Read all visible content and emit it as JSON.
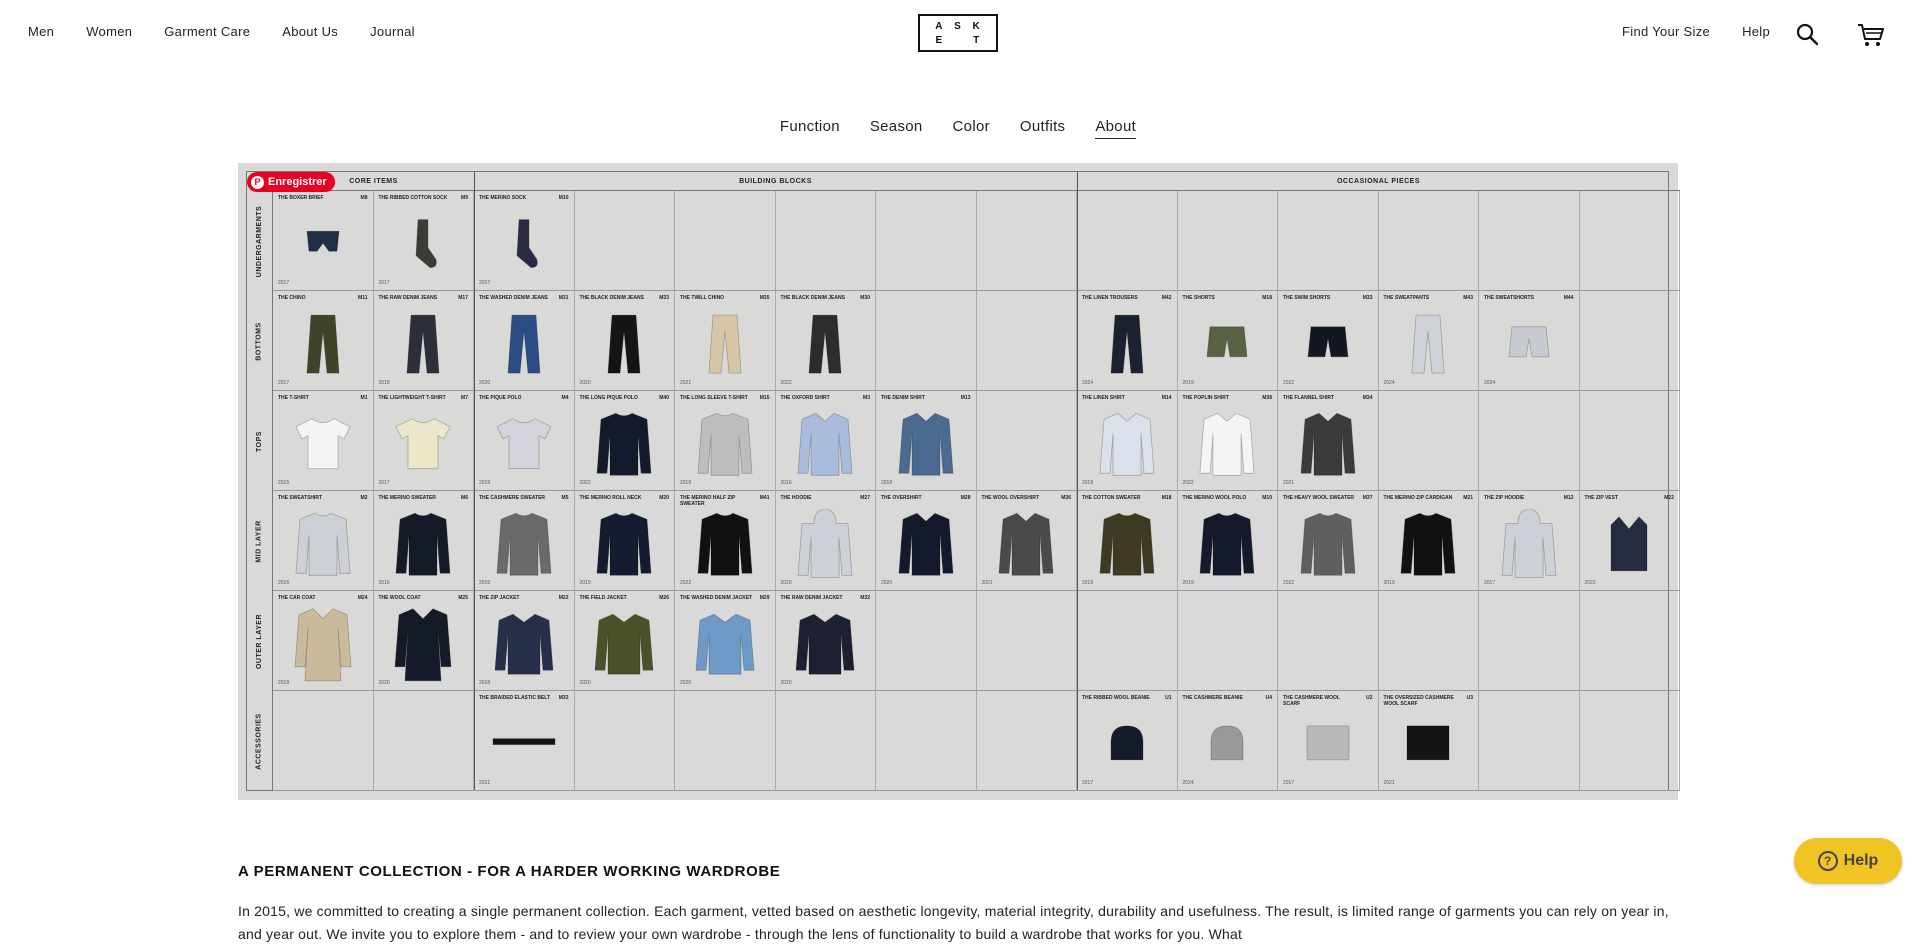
{
  "header": {
    "nav_left": [
      "Men",
      "Women",
      "Garment Care",
      "About Us",
      "Journal"
    ],
    "logo_letters": [
      "A",
      "S",
      "K",
      "E",
      "",
      "T"
    ],
    "nav_right": [
      "Find Your Size",
      "Help"
    ]
  },
  "subnav": {
    "items": [
      "Function",
      "Season",
      "Color",
      "Outfits",
      "About"
    ],
    "active": "About"
  },
  "wardrobe": {
    "sections": [
      "CORE ITEMS",
      "BUILDING BLOCKS",
      "OCCASIONAL PIECES"
    ],
    "rows": [
      "UNDERGARMENTS",
      "BOTTOMS",
      "TOPS",
      "MID LAYER",
      "OUTER LAYER",
      "ACCESSORIES"
    ],
    "pin_label": "Enregistrer",
    "cells": [
      [
        {
          "t": "THE BOXER BRIEF",
          "c": "M8",
          "y": "2017",
          "g": "brief",
          "col": "#1f2d45"
        },
        {
          "t": "THE RIBBED COTTON SOCK",
          "c": "M9",
          "y": "2017",
          "g": "sock",
          "col": "#3b3b38"
        },
        {
          "t": "THE MERINO SOCK",
          "c": "M10",
          "y": "2017",
          "g": "sock",
          "col": "#2a2a45"
        },
        null,
        null,
        null,
        null,
        null,
        null,
        null,
        null,
        null,
        null,
        null
      ],
      [
        {
          "t": "THE CHINO",
          "c": "M11",
          "y": "2017",
          "g": "pants",
          "col": "#3f4429"
        },
        {
          "t": "THE RAW DENIM JEANS",
          "c": "M17",
          "y": "2018",
          "g": "pants",
          "col": "#2c2f3a"
        },
        {
          "t": "THE WASHED DENIM JEANS",
          "c": "M31",
          "y": "2020",
          "g": "pants",
          "col": "#2a4d86"
        },
        {
          "t": "THE BLACK DENIM JEANS",
          "c": "M33",
          "y": "2020",
          "g": "pants",
          "col": "#141414"
        },
        {
          "t": "THE TWILL CHINO",
          "c": "M35",
          "y": "2021",
          "g": "pants",
          "col": "#d6c6a5"
        },
        {
          "t": "THE BLACK DENIM JEANS",
          "c": "M30",
          "y": "2022",
          "g": "pants",
          "col": "#2b2d2d"
        },
        null,
        null,
        {
          "t": "THE LINEN TROUSERS",
          "c": "M42",
          "y": "2024",
          "g": "pants",
          "col": "#1c2130"
        },
        {
          "t": "THE SHORTS",
          "c": "M18",
          "y": "2019",
          "g": "shorts",
          "col": "#5a6244"
        },
        {
          "t": "THE SWIM SHORTS",
          "c": "M33",
          "y": "2022",
          "g": "shorts",
          "col": "#121722"
        },
        {
          "t": "THE SWEATPANTS",
          "c": "M43",
          "y": "2024",
          "g": "pants",
          "col": "#cfd2d6"
        },
        {
          "t": "THE SWEATSHORTS",
          "c": "M44",
          "y": "2024",
          "g": "shorts",
          "col": "#c8ccd2"
        },
        null
      ],
      [
        {
          "t": "THE T-SHIRT",
          "c": "M1",
          "y": "2015",
          "g": "tee",
          "col": "#f4f4f4"
        },
        {
          "t": "THE LIGHTWEIGHT T-SHIRT",
          "c": "M7",
          "y": "2017",
          "g": "tee",
          "col": "#ece7c8"
        },
        {
          "t": "THE PIQUE POLO",
          "c": "M4",
          "y": "2019",
          "g": "tee",
          "col": "#d3d4dc"
        },
        {
          "t": "THE LONG PIQUE POLO",
          "c": "M40",
          "y": "2022",
          "g": "sweater",
          "col": "#141a2b"
        },
        {
          "t": "THE LONG SLEEVE T-SHIRT",
          "c": "M15",
          "y": "2018",
          "g": "sweater",
          "col": "#bdbdbd"
        },
        {
          "t": "THE OXFORD SHIRT",
          "c": "M3",
          "y": "2016",
          "g": "shirt",
          "col": "#a9bcdd"
        },
        {
          "t": "THE DENIM SHIRT",
          "c": "M13",
          "y": "2018",
          "g": "shirt",
          "col": "#4b6a90"
        },
        null,
        {
          "t": "THE LINEN SHIRT",
          "c": "M14",
          "y": "2018",
          "g": "shirt",
          "col": "#dbe1ea"
        },
        {
          "t": "THE POPLIN SHIRT",
          "c": "M38",
          "y": "2022",
          "g": "shirt",
          "col": "#f4f4f4"
        },
        {
          "t": "THE FLANNEL SHIRT",
          "c": "M34",
          "y": "2021",
          "g": "shirt",
          "col": "#3a3a3a"
        },
        null,
        null,
        null
      ],
      [
        {
          "t": "THE SWEATSHIRT",
          "c": "M2",
          "y": "2016",
          "g": "sweater",
          "col": "#cdd0d6"
        },
        {
          "t": "THE MERINO SWEATER",
          "c": "M6",
          "y": "2016",
          "g": "sweater",
          "col": "#141a28"
        },
        {
          "t": "THE CASHMERE SWEATER",
          "c": "M5",
          "y": "2016",
          "g": "sweater",
          "col": "#6a6a6a"
        },
        {
          "t": "THE MERINO ROLL NECK",
          "c": "M20",
          "y": "2019",
          "g": "sweater",
          "col": "#141b2e"
        },
        {
          "t": "THE MERINO HALF ZIP SWEATER",
          "c": "M41",
          "y": "2022",
          "g": "sweater",
          "col": "#111111"
        },
        {
          "t": "THE HOODIE",
          "c": "M27",
          "y": "2020",
          "g": "hoodie",
          "col": "#cdd0d6"
        },
        {
          "t": "THE OVERSHIRT",
          "c": "M28",
          "y": "2020",
          "g": "shirt",
          "col": "#141a2b"
        },
        {
          "t": "THE WOOL OVERSHIRT",
          "c": "M36",
          "y": "2021",
          "g": "shirt",
          "col": "#4a4a4a"
        },
        {
          "t": "THE COTTON SWEATER",
          "c": "M18",
          "y": "2019",
          "g": "sweater",
          "col": "#3e3a22"
        },
        {
          "t": "THE MERINO WOOL POLO",
          "c": "M10",
          "y": "2019",
          "g": "sweater",
          "col": "#141a2b"
        },
        {
          "t": "THE HEAVY WOOL SWEATER",
          "c": "M37",
          "y": "2022",
          "g": "sweater",
          "col": "#5f5f5f"
        },
        {
          "t": "THE MERINO ZIP CARDIGAN",
          "c": "M21",
          "y": "2019",
          "g": "sweater",
          "col": "#111111"
        },
        {
          "t": "THE ZIP HOODIE",
          "c": "M12",
          "y": "2017",
          "g": "hoodie",
          "col": "#cdd0d6"
        },
        {
          "t": "THE ZIP VEST",
          "c": "M22",
          "y": "2022",
          "g": "vest",
          "col": "#252c40"
        }
      ],
      [
        {
          "t": "THE CAR COAT",
          "c": "M24",
          "y": "2018",
          "g": "coat",
          "col": "#c9bb99"
        },
        {
          "t": "THE WOOL COAT",
          "c": "M25",
          "y": "2020",
          "g": "coat",
          "col": "#141a28"
        },
        {
          "t": "THE ZIP JACKET",
          "c": "M22",
          "y": "2018",
          "g": "jacket",
          "col": "#27304a"
        },
        {
          "t": "THE FIELD JACKET",
          "c": "M26",
          "y": "2020",
          "g": "jacket",
          "col": "#4a5129"
        },
        {
          "t": "THE WASHED DENIM JACKET",
          "c": "M29",
          "y": "2020",
          "g": "jacket",
          "col": "#6d9ac7"
        },
        {
          "t": "THE RAW DENIM JACKET",
          "c": "M32",
          "y": "2020",
          "g": "jacket",
          "col": "#1c2030"
        },
        null,
        null,
        null,
        null,
        null,
        null,
        null,
        null
      ],
      [
        null,
        null,
        {
          "t": "THE BRAIDED ELASTIC BELT",
          "c": "M33",
          "y": "2021",
          "g": "belt",
          "col": "#141414"
        },
        null,
        null,
        null,
        null,
        null,
        {
          "t": "THE RIBBED WOOL BEANIE",
          "c": "U1",
          "y": "2017",
          "g": "beanie",
          "col": "#141a28"
        },
        {
          "t": "THE CASHMERE BEANIE",
          "c": "U4",
          "y": "2024",
          "g": "beanie",
          "col": "#9a9a9a"
        },
        {
          "t": "THE CASHMERE WOOL SCARF",
          "c": "U2",
          "y": "2017",
          "g": "scarf",
          "col": "#b8b8b8"
        },
        {
          "t": "THE OVERSIZED CASHMERE WOOL SCARF",
          "c": "U3",
          "y": "2021",
          "g": "scarf",
          "col": "#151515"
        },
        null,
        null
      ]
    ]
  },
  "content": {
    "heading": "A PERMANENT COLLECTION - FOR A HARDER WORKING WARDROBE",
    "paragraph": "In 2015, we committed to creating a single permanent collection. Each garment, vetted based on aesthetic longevity, material integrity, durability and usefulness. The result, is limited range of garments you can rely on year in, and year out. We invite you to explore them - and to review your own wardrobe - through the lens of functionality to build a wardrobe that works for you. What"
  },
  "help_widget": {
    "label": "Help"
  }
}
